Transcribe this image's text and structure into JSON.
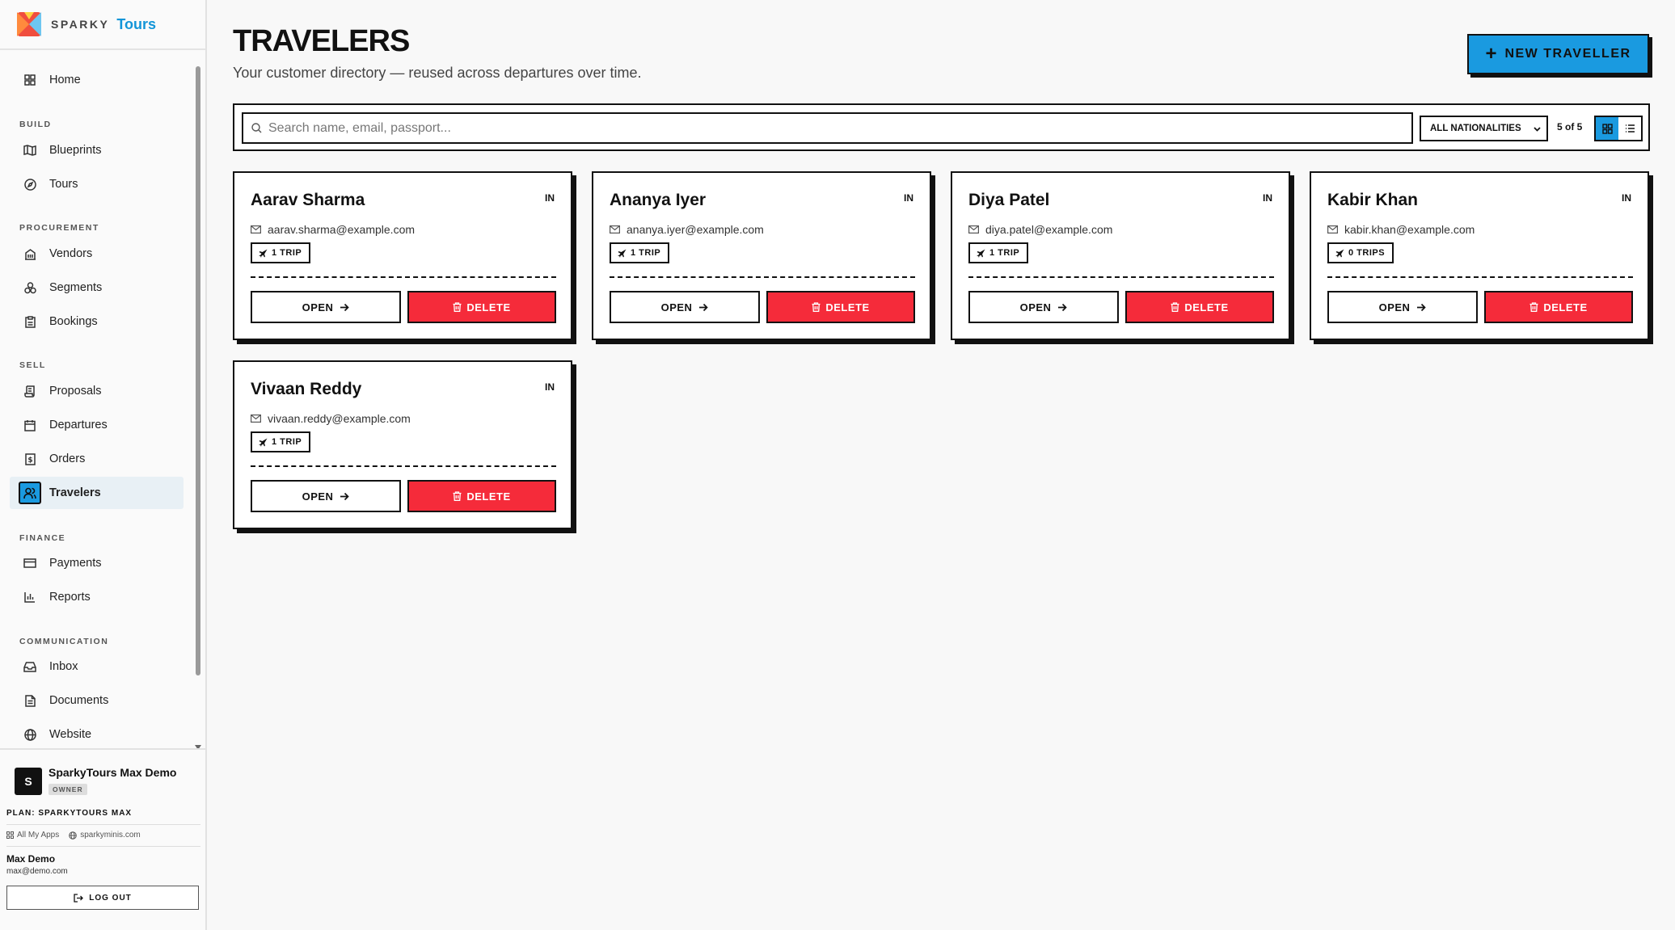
{
  "brand": {
    "sparky": "SPARKY",
    "tours": "Tours"
  },
  "nav": {
    "home": "Home",
    "build": "BUILD",
    "blueprints": "Blueprints",
    "tours": "Tours",
    "procurement": "PROCUREMENT",
    "vendors": "Vendors",
    "segments": "Segments",
    "bookings": "Bookings",
    "sell": "SELL",
    "proposals": "Proposals",
    "departures": "Departures",
    "orders": "Orders",
    "travelers": "Travelers",
    "finance": "FINANCE",
    "payments": "Payments",
    "reports": "Reports",
    "communication": "COMMUNICATION",
    "inbox": "Inbox",
    "documents": "Documents",
    "website": "Website",
    "active": "travelers"
  },
  "org": {
    "avatar": "S",
    "name": "SparkyTours Max Demo",
    "role": "OWNER",
    "plan": "PLAN: SPARKYTOURS MAX",
    "all_apps": "All My Apps",
    "site": "sparkyminis.com"
  },
  "user": {
    "name": "Max Demo",
    "email": "max@demo.com",
    "logout": "LOG OUT"
  },
  "page": {
    "title": "TRAVELERS",
    "subtitle": "Your customer directory — reused across departures over time.",
    "new_button": "NEW TRAVELLER"
  },
  "toolbar": {
    "search_placeholder": "Search name, email, passport...",
    "nationality": "ALL NATIONALITIES",
    "count": "5 of 5",
    "view": "grid"
  },
  "travelers": [
    {
      "name": "Aarav Sharma",
      "nat": "IN",
      "email": "aarav.sharma@example.com",
      "trips": "1 TRIP"
    },
    {
      "name": "Ananya Iyer",
      "nat": "IN",
      "email": "ananya.iyer@example.com",
      "trips": "1 TRIP"
    },
    {
      "name": "Diya Patel",
      "nat": "IN",
      "email": "diya.patel@example.com",
      "trips": "1 TRIP"
    },
    {
      "name": "Kabir Khan",
      "nat": "IN",
      "email": "kabir.khan@example.com",
      "trips": "0 TRIPS"
    },
    {
      "name": "Vivaan Reddy",
      "nat": "IN",
      "email": "vivaan.reddy@example.com",
      "trips": "1 TRIP"
    }
  ],
  "card_actions": {
    "open": "OPEN",
    "delete": "DELETE"
  },
  "colors": {
    "accent": "#1a9ae0",
    "danger": "#f52b3a",
    "ink": "#111111"
  }
}
